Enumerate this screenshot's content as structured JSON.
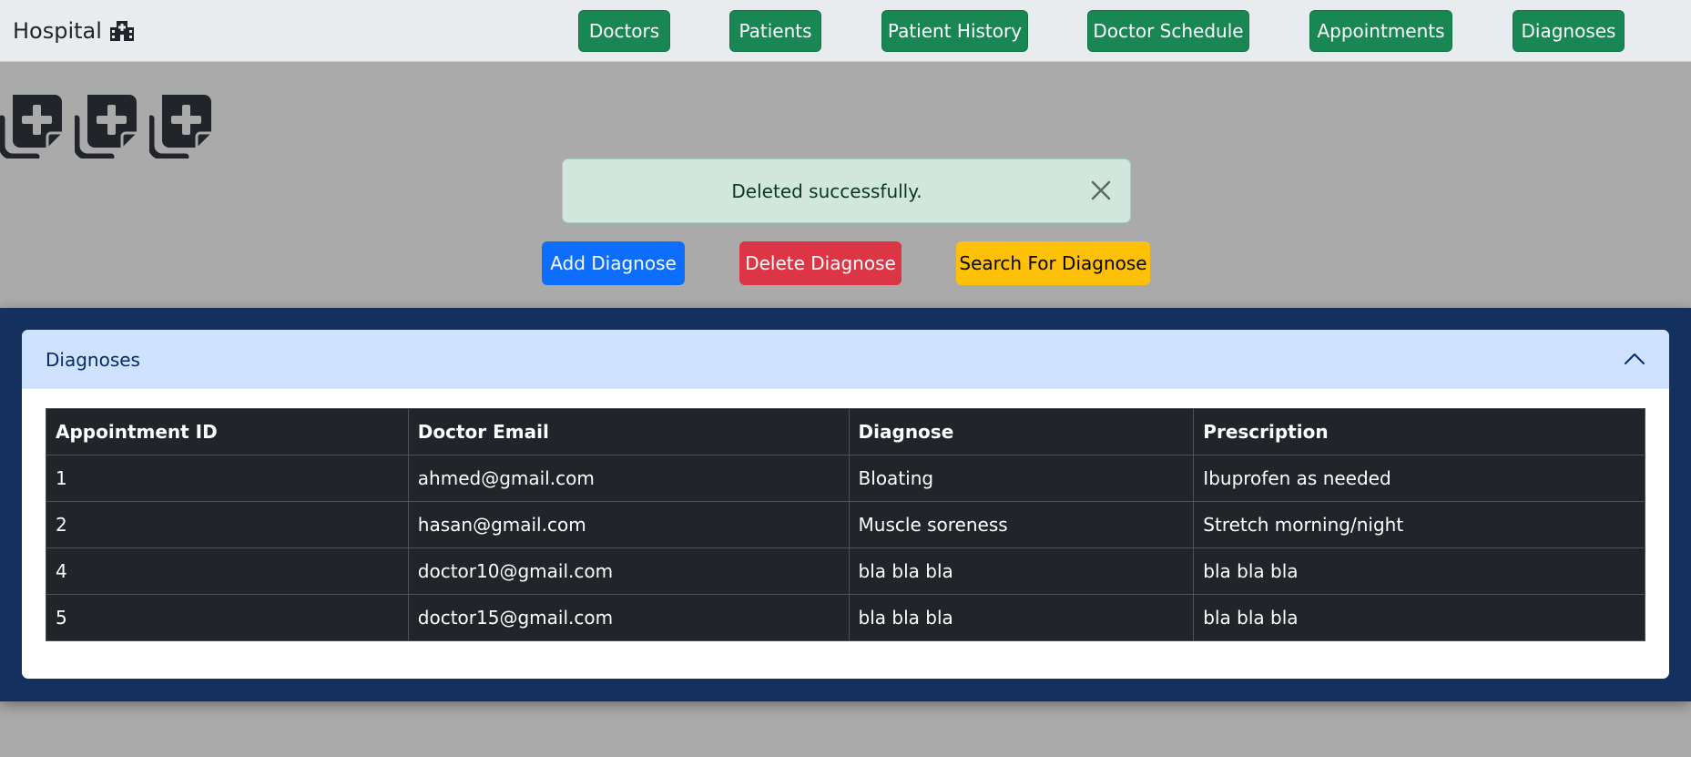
{
  "navbar": {
    "brand": "Hospital",
    "brand_icon": "hospital-icon",
    "links": [
      {
        "label": "Doctors"
      },
      {
        "label": "Patients"
      },
      {
        "label": "Patient History"
      },
      {
        "label": "Doctor Schedule"
      },
      {
        "label": "Appointments"
      },
      {
        "label": "Diagnoses"
      }
    ],
    "link_color": "#198754"
  },
  "logos": {
    "icon": "medical-files-icon",
    "count": 3
  },
  "alert": {
    "message": "Deleted successfully.",
    "color": "#d1e7dd"
  },
  "actions": {
    "add_label": "Add Diagnose",
    "delete_label": "Delete Diagnose",
    "search_label": "Search For Diagnose"
  },
  "panel": {
    "background": "#14305f",
    "accordion_title": "Diagnoses",
    "expanded": true
  },
  "table": {
    "columns": [
      "Appointment ID",
      "Doctor Email",
      "Diagnose",
      "Prescription"
    ],
    "rows": [
      [
        "1",
        "ahmed@gmail.com",
        "Bloating",
        "Ibuprofen as needed"
      ],
      [
        "2",
        "hasan@gmail.com",
        "Muscle soreness",
        "Stretch morning/night"
      ],
      [
        "4",
        "doctor10@gmail.com",
        "bla bla bla",
        "bla bla bla"
      ],
      [
        "5",
        "doctor15@gmail.com",
        "bla bla bla",
        "bla bla bla"
      ]
    ]
  }
}
